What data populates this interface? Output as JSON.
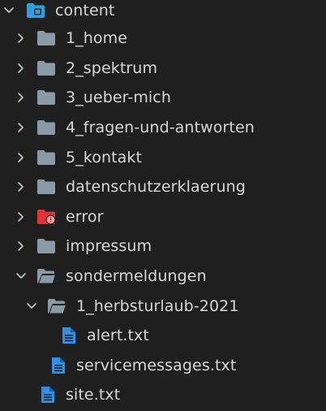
{
  "explorer": {
    "items": [
      {
        "label": "content",
        "kind": "folder-root-open",
        "icon": "folder-open-icon",
        "expanded": true
      },
      {
        "label": "1_home",
        "kind": "folder",
        "icon": "folder-icon",
        "expanded": false
      },
      {
        "label": "2_spektrum",
        "kind": "folder",
        "icon": "folder-icon",
        "expanded": false
      },
      {
        "label": "3_ueber-mich",
        "kind": "folder",
        "icon": "folder-icon",
        "expanded": false
      },
      {
        "label": "4_fragen-und-antworten",
        "kind": "folder",
        "icon": "folder-icon",
        "expanded": false
      },
      {
        "label": "5_kontakt",
        "kind": "folder",
        "icon": "folder-icon",
        "expanded": false
      },
      {
        "label": "datenschutzerklaerung",
        "kind": "folder",
        "icon": "folder-icon",
        "expanded": false
      },
      {
        "label": "error",
        "kind": "folder-error",
        "icon": "folder-error-icon",
        "expanded": false
      },
      {
        "label": "impressum",
        "kind": "folder",
        "icon": "folder-icon",
        "expanded": false
      },
      {
        "label": "sondermeldungen",
        "kind": "folder-open",
        "icon": "folder-open-icon",
        "expanded": true
      },
      {
        "label": "1_herbsturlaub-2021",
        "kind": "folder-open",
        "icon": "folder-open-icon",
        "expanded": true
      },
      {
        "label": "alert.txt",
        "kind": "file",
        "icon": "text-file-icon"
      },
      {
        "label": "servicemessages.txt",
        "kind": "file",
        "icon": "text-file-icon"
      },
      {
        "label": "site.txt",
        "kind": "file",
        "icon": "text-file-icon"
      }
    ]
  },
  "colors": {
    "background": "#1f1f20",
    "text": "#d8d8d8",
    "folder": "#8a9aa7",
    "root_folder": "#29a3e0",
    "file": "#2f8fe6",
    "error_folder": "#e5303a",
    "chevron": "#c8c8c8"
  }
}
